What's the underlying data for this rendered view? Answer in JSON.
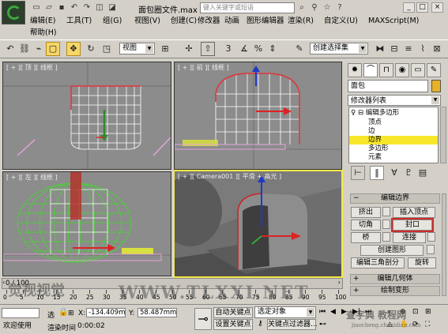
{
  "window": {
    "title": "面包圈文件.max",
    "search_placeholder": "键入关键字或短语",
    "controls": [
      "_",
      "□",
      "×"
    ]
  },
  "menu": {
    "items": [
      "编辑(E)",
      "工具(T)",
      "组(G)",
      "视图(V)",
      "创建(C)",
      "修改器",
      "动画",
      "图形编辑器",
      "渲染(R)",
      "自定义(U)",
      "MAXScript(M)"
    ],
    "second_row": [
      "帮助(H)"
    ]
  },
  "toolbar": {
    "view_dropdown": "视图",
    "selection_set_dropdown": "创建选择集",
    "snap_value": "3"
  },
  "viewports": {
    "top": "[ + ][ 顶 ][ 线框 ]",
    "front": "[ + ][ 前 ][ 线框 ]",
    "left": "[ + ][ 左 ][ 线框 ]",
    "camera": "[ + ][ Camera001 ][ 平滑 + 高光 ]"
  },
  "command_panel": {
    "object_name": "面包",
    "modifier_list": "修改器列表",
    "stack": [
      {
        "label": "编辑多边形",
        "level": 0
      },
      {
        "label": "顶点",
        "level": 1
      },
      {
        "label": "边",
        "level": 1
      },
      {
        "label": "边界",
        "level": 1,
        "selected": true
      },
      {
        "label": "多边形",
        "level": 1
      },
      {
        "label": "元素",
        "level": 1
      }
    ],
    "rollouts": {
      "edit_borders": "编辑边界",
      "edit_geometry": "编辑几何体",
      "paint_deformation": "绘制变形"
    },
    "buttons": {
      "extrude": "挤出",
      "insert_vertex": "插入顶点",
      "chamfer": "切角",
      "cap": "封口",
      "bridge": "桥",
      "connect": "连接",
      "create_shape": "创建图形",
      "edit_triangulation": "编辑三角剖分",
      "turn": "旋转"
    }
  },
  "timeline": {
    "frame_indicator": "0 / 100",
    "ticks": [
      0,
      5,
      10,
      15,
      20,
      25,
      30,
      35,
      40,
      45,
      50,
      55,
      60,
      65,
      70,
      75,
      80,
      85,
      90,
      95,
      100
    ]
  },
  "statusbar": {
    "welcome": "欢迎使用",
    "selected_label": "选",
    "x_label": "X:",
    "x_value": "-134.409m",
    "y_label": "Y:",
    "y_value": "58.487mm",
    "auto_key": "自动关键点",
    "selected_object": "选定对象",
    "set_key": "设置关键点",
    "key_filters": "关键点过滤器...",
    "render_time_label": "渲染时间",
    "render_time": "0:00:02"
  },
  "watermarks": {
    "center": "WWW.TLXXI.NET",
    "left": "觉视视觉",
    "bottom_right": "查字典 教程网",
    "bottom_right_url": "jiaocheng.chazidian.com"
  },
  "colors": {
    "selection_yellow": "#f7e72a",
    "active_tool": "#f7d668",
    "highlight_red": "#d12a2a",
    "wire_green": "#3fdc2a",
    "viewport_gray": "#8c8c8c"
  }
}
